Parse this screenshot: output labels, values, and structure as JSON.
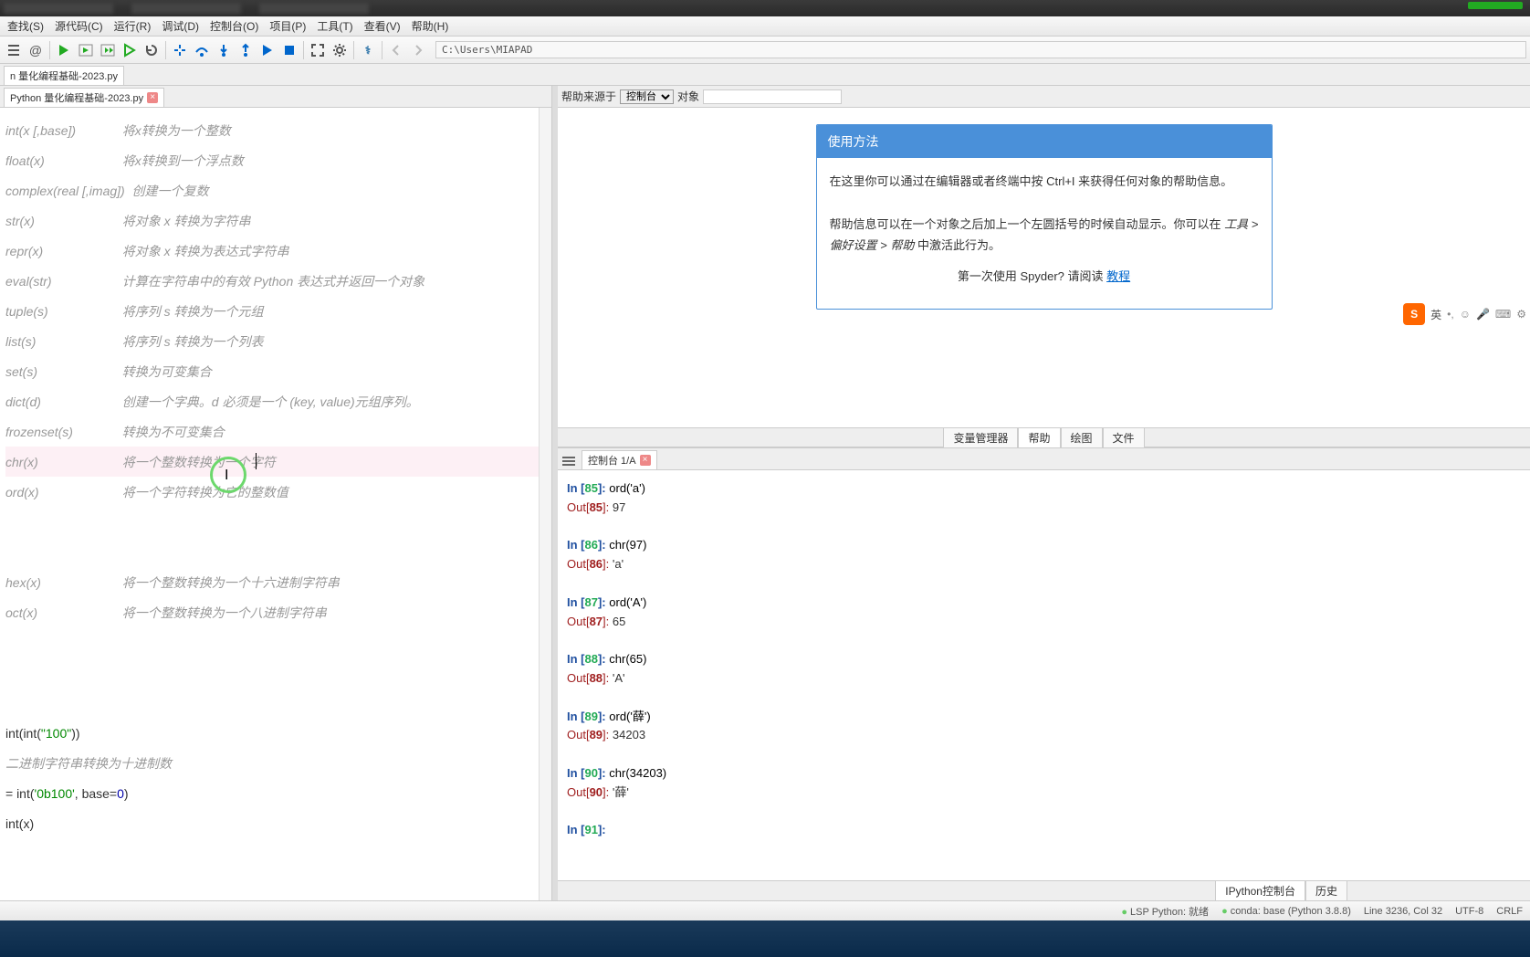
{
  "menus": [
    "查找(S)",
    "源代码(C)",
    "运行(R)",
    "调试(D)",
    "控制台(O)",
    "项目(P)",
    "工具(T)",
    "查看(V)",
    "帮助(H)"
  ],
  "path": "C:\\Users\\MIAPAD",
  "project_tab": "n 量化编程基础-2023.py",
  "editor_tab": "Python 量化编程基础-2023.py",
  "code_lines": [
    {
      "fn": "int(x [,base])",
      "cmt": "将x转换为一个整数"
    },
    {
      "fn": "float(x)",
      "cmt": "将x转换到一个浮点数"
    },
    {
      "fn": "complex(real [,imag])",
      "cmt": "创建一个复数"
    },
    {
      "fn": "str(x)",
      "cmt": "将对象 x 转换为字符串"
    },
    {
      "fn": "repr(x)",
      "cmt": "将对象 x 转换为表达式字符串"
    },
    {
      "fn": "eval(str)",
      "cmt": "计算在字符串中的有效 Python 表达式并返回一个对象"
    },
    {
      "fn": "tuple(s)",
      "cmt": "将序列 s 转换为一个元组"
    },
    {
      "fn": "list(s)",
      "cmt": "将序列 s 转换为一个列表"
    },
    {
      "fn": "set(s)",
      "cmt": "转换为可变集合"
    },
    {
      "fn": "dict(d)",
      "cmt": "创建一个字典。d 必须是一个 (key, value)元组序列。"
    },
    {
      "fn": "frozenset(s)",
      "cmt": "转换为不可变集合"
    },
    {
      "fn": "chr(x)",
      "cmt": "将一个整数转换为一个字符",
      "active": true
    },
    {
      "fn": "ord(x)",
      "cmt": "将一个字符转换为它的整数值"
    },
    {
      "fn": "",
      "cmt": ""
    },
    {
      "fn": "",
      "cmt": ""
    },
    {
      "fn": "hex(x)",
      "cmt": "将一个整数转换为一个十六进制字符串"
    },
    {
      "fn": "oct(x)",
      "cmt": "将一个整数转换为一个八进制字符串"
    }
  ],
  "code_tail": {
    "l1": "int(int(\"100\"))",
    "l2": "二进制字符串转换为十进制数",
    "l3": "= int('0b100', base=0)",
    "l4": "int(x)"
  },
  "help": {
    "source_label": "帮助来源于",
    "source_select": "控制台",
    "obj_label": "对象",
    "title": "使用方法",
    "p1": "在这里你可以通过在编辑器或者终端中按 Ctrl+I 来获得任何对象的帮助信息。",
    "p2a": "帮助信息可以在一个对象之后加上一个左圆括号的时候自动显示。你可以在 ",
    "p2b": "工具 > 偏好设置 > 帮助",
    "p2c": " 中激活此行为。",
    "link_pre": "第一次使用 Spyder? 请阅读 ",
    "link": "教程"
  },
  "help_tabs": [
    "变量管理器",
    "帮助",
    "绘图",
    "文件"
  ],
  "help_active": "帮助",
  "ime": "英",
  "console_tab": "控制台 1/A",
  "console": [
    {
      "in": 85,
      "code": "ord('a')",
      "out": "97"
    },
    {
      "in": 86,
      "code": "chr(97)",
      "out": "'a'"
    },
    {
      "in": 87,
      "code": "ord('A')",
      "out": "65"
    },
    {
      "in": 88,
      "code": "chr(65)",
      "out": "'A'"
    },
    {
      "in": 89,
      "code": "ord('薛')",
      "out": "34203"
    },
    {
      "in": 90,
      "code": "chr(34203)",
      "out": "'薛'"
    }
  ],
  "console_prompt": 91,
  "console_btabs": [
    "IPython控制台",
    "历史"
  ],
  "status": {
    "lsp": "LSP Python: 就绪",
    "conda": "conda: base (Python 3.8.8)",
    "pos": "Line 3236, Col 32",
    "enc": "UTF-8",
    "eol": "CRLF"
  }
}
